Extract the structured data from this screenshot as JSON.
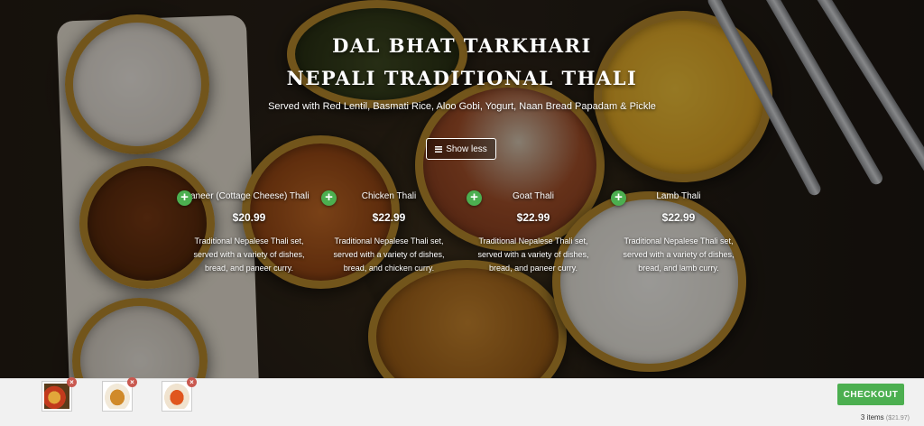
{
  "hero": {
    "title_line1": "DAL BHAT TARKHARI",
    "title_line2": "NEPALI TRADITIONAL THALI",
    "subtitle": "Served with Red Lentil, Basmati Rice, Aloo Gobi, Yogurt, Naan Bread Papadam & Pickle",
    "toggle_label": "Show less",
    "toggle_icon": "menu-icon"
  },
  "items": [
    {
      "name": "aneer (Cottage Cheese) Thali",
      "price": "$20.99",
      "description": "Traditional Nepalese Thali set, served with a variety of dishes, bread, and paneer curry.",
      "add_icon": "plus-icon",
      "add_symbol": "+"
    },
    {
      "name": "Chicken Thali",
      "price": "$22.99",
      "description": "Traditional Nepalese Thali set, served with a variety of dishes, bread, and chicken curry.",
      "add_icon": "plus-icon",
      "add_symbol": "+"
    },
    {
      "name": "Goat Thali",
      "price": "$22.99",
      "description": "Traditional Nepalese Thali set, served with a variety of dishes, bread, and paneer curry.",
      "add_icon": "plus-icon",
      "add_symbol": "+"
    },
    {
      "name": "Lamb Thali",
      "price": "$22.99",
      "description": "Traditional Nepalese Thali set, served with a variety of dishes, bread, and lamb curry.",
      "add_icon": "plus-icon",
      "add_symbol": "+"
    }
  ],
  "cart": {
    "remove_symbol": "×",
    "thumbnails": [
      "cart-item-thumbnail-1",
      "cart-item-thumbnail-2",
      "cart-item-thumbnail-3"
    ],
    "checkout_label": "CHECKOUT",
    "items_count": "3 items",
    "items_total": "($21.97)"
  },
  "colors": {
    "add_button": "#4caf50",
    "checkout_button": "#4caf50",
    "remove_badge": "#c9584f",
    "cart_bar_bg": "#f1f1f1"
  }
}
